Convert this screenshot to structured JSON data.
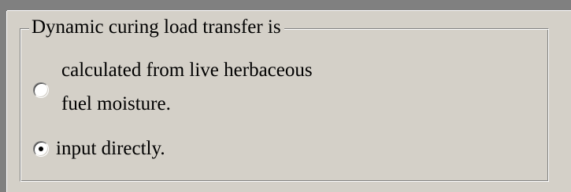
{
  "groupbox": {
    "title": "Dynamic curing load transfer is"
  },
  "options": [
    {
      "line1": "calculated from live herbaceous",
      "line2": "fuel moisture.",
      "selected": false
    },
    {
      "line1": "input directly.",
      "selected": true
    }
  ],
  "colors": {
    "background": "#d4d0c8",
    "shadow": "#808080",
    "highlight": "#ffffff"
  }
}
